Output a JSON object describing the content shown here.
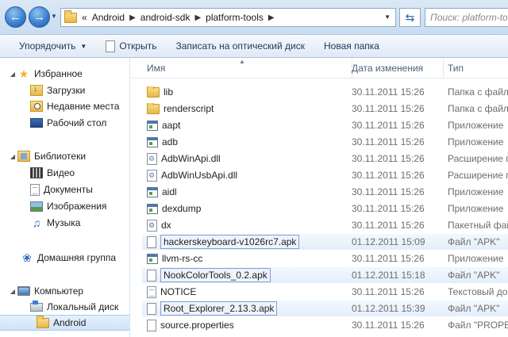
{
  "address": {
    "overflow": "«",
    "crumbs": [
      "Android",
      "android-sdk",
      "platform-tools"
    ],
    "search_placeholder": "Поиск: platform-tools"
  },
  "toolbar": {
    "organize": "Упорядочить",
    "open": "Открыть",
    "burn": "Записать на оптический диск",
    "new_folder": "Новая папка"
  },
  "nav": {
    "favorites": "Избранное",
    "downloads": "Загрузки",
    "recent": "Недавние места",
    "desktop": "Рабочий стол",
    "libraries": "Библиотеки",
    "video": "Видео",
    "documents": "Документы",
    "images": "Изображения",
    "music": "Музыка",
    "homegroup": "Домашняя группа",
    "computer": "Компьютер",
    "local_disk": "Локальный диск",
    "android": "Android"
  },
  "columns": {
    "name": "Имя",
    "date": "Дата изменения",
    "type": "Тип"
  },
  "files": [
    {
      "name": "lib",
      "date": "30.11.2011 15:26",
      "type": "Папка с файл",
      "icon": "folder-icon"
    },
    {
      "name": "renderscript",
      "date": "30.11.2011 15:26",
      "type": "Папка с файл",
      "icon": "folder-icon"
    },
    {
      "name": "aapt",
      "date": "30.11.2011 15:26",
      "type": "Приложение",
      "icon": "exe-icon"
    },
    {
      "name": "adb",
      "date": "30.11.2011 15:26",
      "type": "Приложение",
      "icon": "exe-icon"
    },
    {
      "name": "AdbWinApi.dll",
      "date": "30.11.2011 15:26",
      "type": "Расширение п",
      "icon": "dll-icon"
    },
    {
      "name": "AdbWinUsbApi.dll",
      "date": "30.11.2011 15:26",
      "type": "Расширение п",
      "icon": "dll-icon"
    },
    {
      "name": "aidl",
      "date": "30.11.2011 15:26",
      "type": "Приложение",
      "icon": "exe-icon"
    },
    {
      "name": "dexdump",
      "date": "30.11.2011 15:26",
      "type": "Приложение",
      "icon": "exe-icon"
    },
    {
      "name": "dx",
      "date": "30.11.2011 15:26",
      "type": "Пакетный фай",
      "icon": "batch-icon"
    },
    {
      "name": "hackerskeyboard-v1026rc7.apk",
      "date": "01.12.2011 15:09",
      "type": "Файл \"APK\"",
      "icon": "file-icon"
    },
    {
      "name": "llvm-rs-cc",
      "date": "30.11.2011 15:26",
      "type": "Приложение",
      "icon": "exe-icon"
    },
    {
      "name": "NookColorTools_0.2.apk",
      "date": "01.12.2011 15:18",
      "type": "Файл \"APK\"",
      "icon": "file-icon"
    },
    {
      "name": "NOTICE",
      "date": "30.11.2011 15:26",
      "type": "Текстовый док",
      "icon": "text-file-icon"
    },
    {
      "name": "Root_Explorer_2.13.3.apk",
      "date": "01.12.2011 15:39",
      "type": "Файл \"APK\"",
      "icon": "file-icon"
    },
    {
      "name": "source.properties",
      "date": "30.11.2011 15:26",
      "type": "Файл \"PROPE",
      "icon": "file-icon"
    }
  ]
}
